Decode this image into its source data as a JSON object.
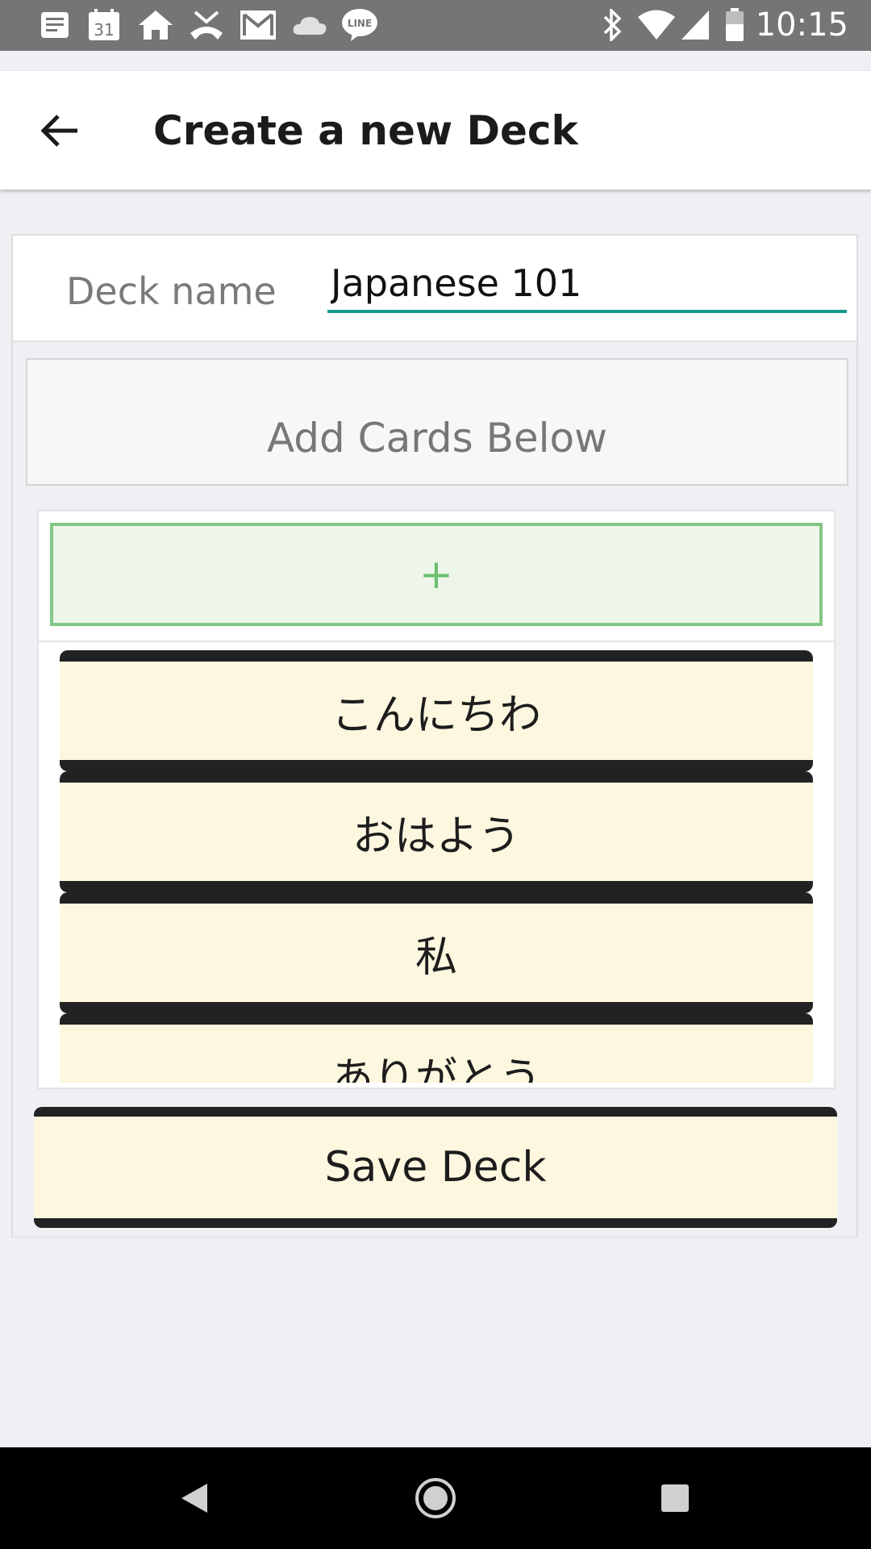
{
  "status_bar": {
    "time": "10:15",
    "calendar_day": "31",
    "left_icons": [
      "notes-icon",
      "calendar-icon",
      "home-icon",
      "missed-call-icon",
      "gmail-icon",
      "cloud-icon",
      "line-app-icon"
    ],
    "right_icons": [
      "bluetooth-icon",
      "wifi-icon",
      "signal-icon",
      "battery-icon"
    ],
    "line_label": "LINE"
  },
  "app_bar": {
    "title": "Create a new Deck",
    "back_icon": "back-arrow-icon"
  },
  "deck": {
    "label": "Deck name",
    "value": "Japanese 101"
  },
  "cards_section": {
    "header": "Add Cards Below",
    "add_label": "+",
    "cards": [
      "こんにちわ",
      "おはよう",
      "私",
      "ありがとう"
    ]
  },
  "save_label": "Save Deck",
  "colors": {
    "accent": "#13998a",
    "add_border": "#82c785",
    "card_bg": "#fdf7e0",
    "status_bar": "#757575"
  },
  "nav_bar": {
    "icons": [
      "nav-back-icon",
      "nav-home-icon",
      "nav-recents-icon"
    ]
  }
}
